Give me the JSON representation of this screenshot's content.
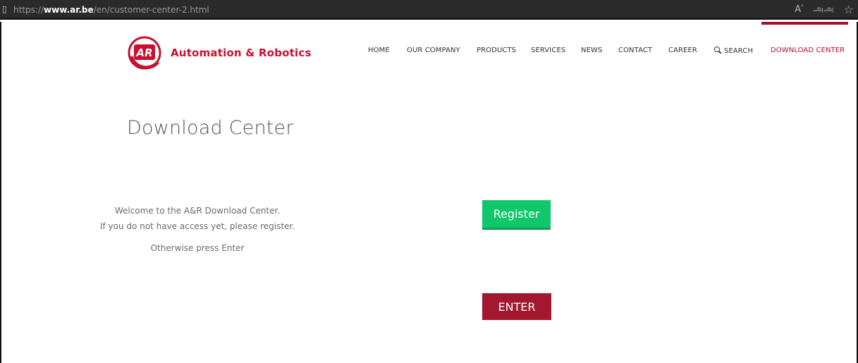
{
  "browser": {
    "url_prefix": "https://",
    "url_host": "www.ar.be",
    "url_path": "/en/customer-center-2.html",
    "read_aloud_icon_text": "Aʹ",
    "translate_icon_text": "அஅ",
    "favorite_icon_text": "☆"
  },
  "header": {
    "logo_text": "Automation & Robotics",
    "logo_mark_text": "AR",
    "brand_color": "#c8102e"
  },
  "nav": {
    "items": [
      {
        "label": "HOME"
      },
      {
        "label": "OUR COMPANY"
      },
      {
        "label": "PRODUCTS"
      },
      {
        "label": "SERVICES"
      },
      {
        "label": "NEWS"
      },
      {
        "label": "CONTACT"
      },
      {
        "label": "CAREER"
      },
      {
        "label": "SEARCH",
        "icon": "search-icon"
      },
      {
        "label": "DOWNLOAD CENTER",
        "active": true
      }
    ],
    "active_color": "#b0122c"
  },
  "main": {
    "title": "Download Center",
    "welcome_line1": "Welcome to the A&R Download Center.",
    "welcome_line2": "If you do not have access yet, please register.",
    "welcome_line3": "Otherwise press Enter",
    "register_label": "Register",
    "enter_label": "ENTER",
    "register_color": "#10c76a",
    "enter_color": "#a3182f"
  }
}
